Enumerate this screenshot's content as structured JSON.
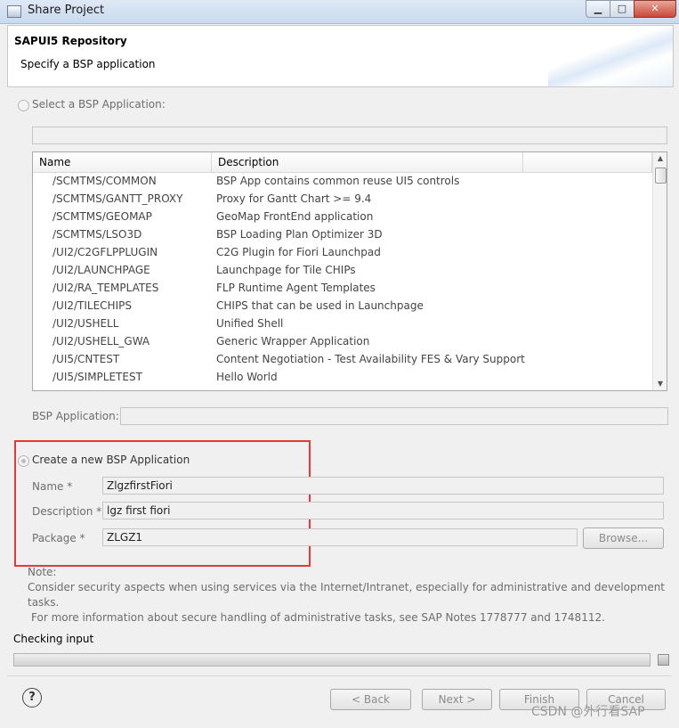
{
  "window": {
    "title": "Share Project"
  },
  "header": {
    "title": "SAPUI5 Repository",
    "subtitle": "Specify a BSP application"
  },
  "select_section": {
    "radio_label": "Select a BSP Application:",
    "filter_value": ""
  },
  "table": {
    "columns": [
      "Name",
      "Description"
    ],
    "rows": [
      {
        "name": "/SCMTMS/COMMON",
        "desc": "BSP App contains common reuse UI5 controls"
      },
      {
        "name": "/SCMTMS/GANTT_PROXY",
        "desc": "Proxy for Gantt Chart >= 9.4"
      },
      {
        "name": "/SCMTMS/GEOMAP",
        "desc": "GeoMap FrontEnd application"
      },
      {
        "name": "/SCMTMS/LSO3D",
        "desc": "BSP Loading Plan Optimizer 3D"
      },
      {
        "name": "/UI2/C2GFLPPLUGIN",
        "desc": "C2G Plugin for Fiori Launchpad"
      },
      {
        "name": "/UI2/LAUNCHPAGE",
        "desc": "Launchpage for Tile CHIPs"
      },
      {
        "name": "/UI2/RA_TEMPLATES",
        "desc": "FLP Runtime Agent Templates"
      },
      {
        "name": "/UI2/TILECHIPS",
        "desc": "CHIPS that can be used in Launchpage"
      },
      {
        "name": "/UI2/USHELL",
        "desc": "Unified Shell"
      },
      {
        "name": "/UI2/USHELL_GWA",
        "desc": "Generic Wrapper Application"
      },
      {
        "name": "/UI5/CNTEST",
        "desc": "Content Negotiation - Test Availability FES & Vary Support"
      },
      {
        "name": "/UI5/SIMPLETEST",
        "desc": "Hello World"
      }
    ]
  },
  "bsp_application": {
    "label": "BSP Application:",
    "value": ""
  },
  "create_section": {
    "radio_label": "Create a new BSP Application",
    "name_label": "Name *",
    "name_value": "ZlgzfirstFiori",
    "description_label": "Description *",
    "description_value": "lgz first fiori",
    "package_label": "Package *",
    "package_value": "ZLGZ1",
    "browse_label": "Browse..."
  },
  "note": {
    "label": "Note:",
    "line1": "Consider security aspects when using services via the Internet/Intranet, especially for administrative and development tasks.",
    "line2": "For more information about secure handling of administrative tasks, see SAP Notes 1778777 and 1748112."
  },
  "status": {
    "checking": "Checking input"
  },
  "buttons": {
    "back": "< Back",
    "next": "Next >",
    "finish": "Finish",
    "cancel": "Cancel"
  },
  "watermark": "CSDN @外行看SAP",
  "colors": {
    "highlight_box": "#e53935",
    "header_bg": "#ffffff",
    "window_bg": "#f0f0f0"
  }
}
